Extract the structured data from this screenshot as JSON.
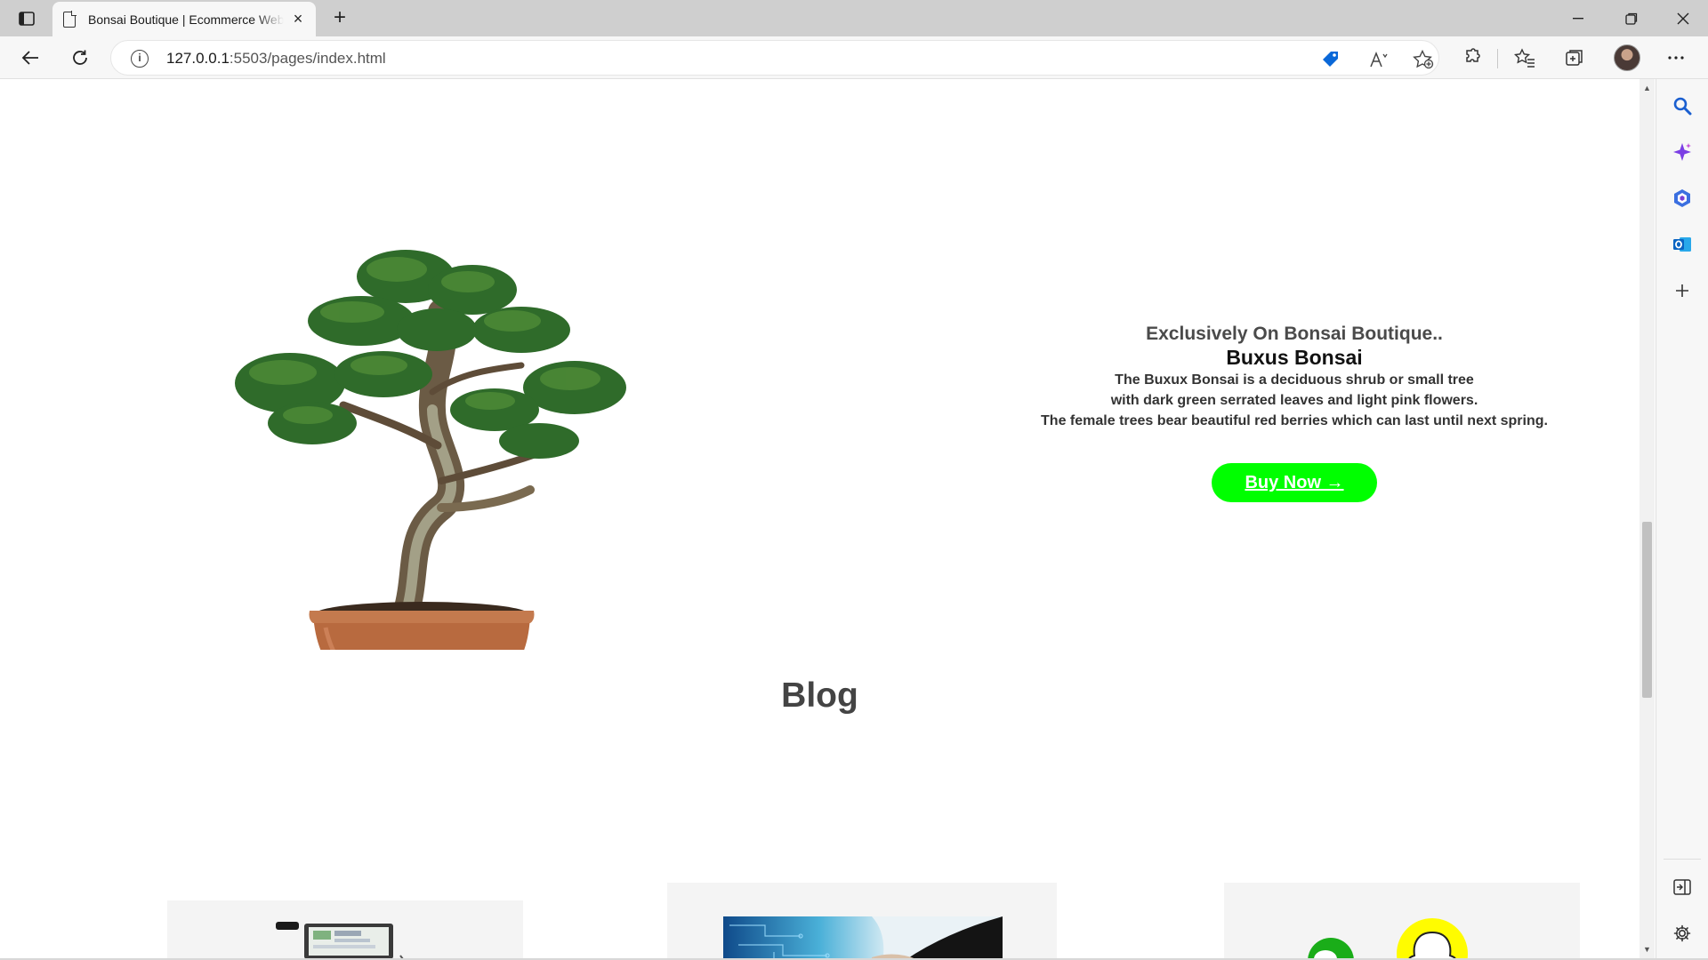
{
  "browser": {
    "tab_title": "Bonsai Boutique | Ecommerce Website",
    "tab_close": "×",
    "new_tab": "+",
    "url_host": "127.0.0.1",
    "url_rest": ":5503/pages/index.html"
  },
  "hero": {
    "kicker": "Exclusively On Bonsai Boutique..",
    "title": "Buxus Bonsai",
    "desc_line1": "The Buxux Bonsai is a deciduous shrub or small tree",
    "desc_line2": "with dark green serrated leaves and light pink flowers.",
    "desc_line3": "The female trees bear beautiful red berries which can last until next spring.",
    "buy_label": "Buy Now →",
    "accent_color": "#00ff00"
  },
  "blog": {
    "heading": "Blog"
  },
  "icons": [
    "tab-actions-icon",
    "page-icon",
    "back-icon",
    "refresh-icon",
    "info-icon",
    "tag-icon",
    "read-aloud-icon",
    "add-favorite-icon",
    "extensions-icon",
    "favorites-icon",
    "collections-icon",
    "more-icon",
    "search-icon",
    "copilot-icon",
    "office-icon",
    "outlook-icon",
    "add-icon",
    "hide-sidebar-icon",
    "settings-icon"
  ]
}
